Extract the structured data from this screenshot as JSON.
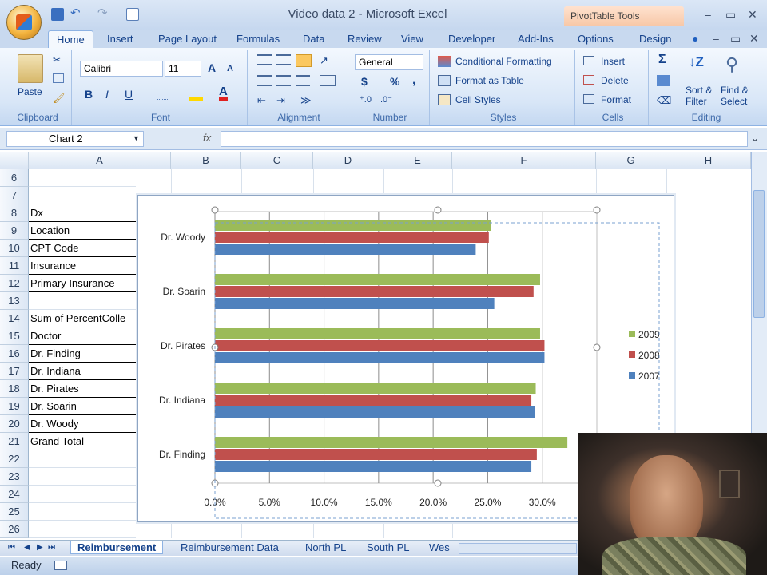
{
  "window": {
    "title": "Video data 2 - Microsoft Excel",
    "context_tab_group": "PivotTable Tools",
    "tabs": [
      "Home",
      "Insert",
      "Page Layout",
      "Formulas",
      "Data",
      "Review",
      "View",
      "Developer",
      "Add-Ins",
      "Options",
      "Design"
    ],
    "active_tab": "Home"
  },
  "ribbon": {
    "clipboard": {
      "label": "Clipboard",
      "paste": "Paste"
    },
    "font": {
      "label": "Font",
      "font_name": "Calibri",
      "font_size": "11",
      "bold": "B",
      "italic": "I",
      "underline": "U"
    },
    "alignment": {
      "label": "Alignment"
    },
    "number": {
      "label": "Number",
      "format": "General",
      "currency": "$",
      "percent": "%",
      "comma": ","
    },
    "styles": {
      "label": "Styles",
      "conditional": "Conditional Formatting",
      "format_table": "Format as Table",
      "cell_styles": "Cell Styles"
    },
    "cells": {
      "label": "Cells",
      "insert": "Insert",
      "delete": "Delete",
      "format": "Format"
    },
    "editing": {
      "label": "Editing",
      "sigma": "Σ",
      "sort_line1": "Sort &",
      "sort_line2": "Filter",
      "find_line1": "Find &",
      "find_line2": "Select"
    }
  },
  "formula_bar": {
    "name_box": "Chart 2",
    "fx": "fx"
  },
  "columns": [
    "A",
    "B",
    "C",
    "D",
    "E",
    "F",
    "G",
    "H"
  ],
  "rows": [
    "6",
    "7",
    "8",
    "9",
    "10",
    "11",
    "12",
    "13",
    "14",
    "15",
    "16",
    "17",
    "18",
    "19",
    "20",
    "21",
    "22",
    "23",
    "24",
    "25",
    "26"
  ],
  "cells_a": [
    "",
    "",
    "Dx",
    "Location",
    "CPT Code",
    "Insurance",
    "Primary Insurance",
    "",
    "Sum of PercentColle",
    "Doctor",
    "Dr. Finding",
    "Dr. Indiana",
    "Dr. Pirates",
    "Dr. Soarin",
    "Dr. Woody",
    "Grand Total",
    "",
    "",
    "",
    "",
    ""
  ],
  "chart_data": {
    "type": "bar",
    "orientation": "horizontal",
    "categories": [
      "Dr. Woody",
      "Dr. Soarin",
      "Dr. Pirates",
      "Dr. Indiana",
      "Dr. Finding"
    ],
    "series": [
      {
        "name": "2009",
        "color": "#9bbb59",
        "values": [
          25.3,
          29.8,
          29.8,
          29.4,
          32.3
        ]
      },
      {
        "name": "2008",
        "color": "#c0504d",
        "values": [
          25.1,
          29.2,
          30.2,
          29.0,
          29.5
        ]
      },
      {
        "name": "2007",
        "color": "#4f81bd",
        "values": [
          23.9,
          25.6,
          30.2,
          29.3,
          29.0
        ]
      }
    ],
    "xticks": [
      "0.0%",
      "5.0%",
      "10.0%",
      "15.0%",
      "20.0%",
      "25.0%",
      "30.0%"
    ],
    "xlim": [
      0,
      35
    ],
    "grid": true,
    "legend": "right"
  },
  "sheet_tabs": [
    "Reimbursement",
    "Reimbursement Data",
    "North PL",
    "South PL",
    "Wes"
  ],
  "active_sheet": "Reimbursement",
  "status": {
    "ready": "Ready"
  }
}
